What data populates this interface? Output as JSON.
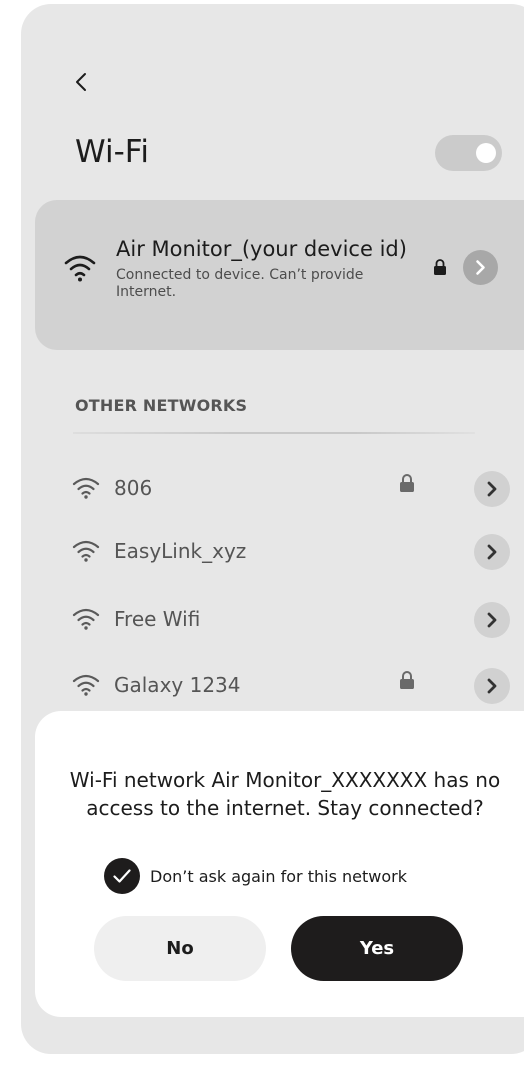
{
  "header": {
    "title": "Wi-Fi",
    "wifi_enabled": true
  },
  "connected": {
    "name": "Air Monitor_(your device id)",
    "status": "Connected to device. Can’t provide Internet."
  },
  "other_networks": {
    "label": "OTHER NETWORKS",
    "items": [
      {
        "name": "806",
        "locked": true
      },
      {
        "name": "EasyLink_xyz",
        "locked": false
      },
      {
        "name": "Free Wifi",
        "locked": false
      },
      {
        "name": "Galaxy 1234",
        "locked": true
      }
    ]
  },
  "dialog": {
    "message": "Wi-Fi network Air Monitor_XXXXXXX has no access to the internet. Stay connected?",
    "checkbox_label": "Don’t ask again for this network",
    "checkbox_checked": true,
    "no_label": "No",
    "yes_label": "Yes"
  },
  "colors": {
    "screen_bg": "#e7e7e7",
    "connected_card_bg": "#d2d2d2",
    "dialog_bg": "#ffffff",
    "primary_button": "#1e1c1c"
  }
}
